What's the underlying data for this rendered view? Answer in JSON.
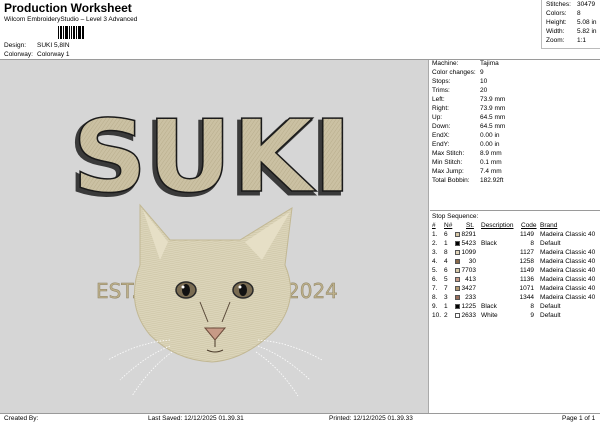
{
  "header": {
    "title": "Production Worksheet",
    "subtitle": "Wilcom EmbroideryStudio – Level 3 Advanced",
    "design_label": "Design:",
    "design_value": "SUKI 5,8IN",
    "colorway_label": "Colorway:",
    "colorway_value": "Colorway 1"
  },
  "stats": [
    {
      "label": "Stitches:",
      "value": "30479"
    },
    {
      "label": "Colors:",
      "value": "8"
    },
    {
      "label": "Height:",
      "value": "5.08 in"
    },
    {
      "label": "Width:",
      "value": "5.82 in"
    },
    {
      "label": "Zoom:",
      "value": "1:1"
    }
  ],
  "design": {
    "word": "SUKI",
    "est": "EST.",
    "year": "2024",
    "colors": {
      "fill": "#cbc1a3",
      "shadow": "#3a3a3a",
      "text": "#bdb08a",
      "fur": "#d9d2b6"
    }
  },
  "machine_info": [
    {
      "label": "Machine:",
      "value": "Tajima"
    },
    {
      "label": "Color changes:",
      "value": "9"
    },
    {
      "label": "Stops:",
      "value": "10"
    },
    {
      "label": "Trims:",
      "value": "20"
    },
    {
      "label": "Left:",
      "value": "73.9 mm"
    },
    {
      "label": "Right:",
      "value": "73.9 mm"
    },
    {
      "label": "Up:",
      "value": "64.5 mm"
    },
    {
      "label": "Down:",
      "value": "64.5 mm"
    },
    {
      "label": "EndX:",
      "value": "0.00 in"
    },
    {
      "label": "EndY:",
      "value": "0.00 in"
    },
    {
      "label": "Max Stitch:",
      "value": "8.9 mm"
    },
    {
      "label": "Min Stitch:",
      "value": "0.1 mm"
    },
    {
      "label": "Max Jump:",
      "value": "7.4 mm"
    },
    {
      "label": "Total Bobbin:",
      "value": "182.92ft"
    }
  ],
  "stop_sequence": {
    "heading": "Stop Sequence:",
    "columns": [
      "#",
      "N#",
      "St.",
      "Description",
      "Code",
      "Brand"
    ],
    "rows": [
      {
        "num": "1.",
        "n": "6",
        "swatch": "#d8c9a8",
        "st": "8291",
        "desc": "",
        "code": "1149",
        "brand": "Madeira Classic 40"
      },
      {
        "num": "2.",
        "n": "1",
        "swatch": "#000000",
        "st": "5423",
        "desc": "Black",
        "code": "8",
        "brand": "Default"
      },
      {
        "num": "3.",
        "n": "8",
        "swatch": "#e3d7bd",
        "st": "1099",
        "desc": "",
        "code": "1127",
        "brand": "Madeira Classic 40"
      },
      {
        "num": "4.",
        "n": "4",
        "swatch": "#8a6a4a",
        "st": "30",
        "desc": "",
        "code": "1258",
        "brand": "Madeira Classic 40"
      },
      {
        "num": "5.",
        "n": "6",
        "swatch": "#d8c9a8",
        "st": "7703",
        "desc": "",
        "code": "1149",
        "brand": "Madeira Classic 40"
      },
      {
        "num": "6.",
        "n": "5",
        "swatch": "#c79a86",
        "st": "413",
        "desc": "",
        "code": "1136",
        "brand": "Madeira Classic 40"
      },
      {
        "num": "7.",
        "n": "7",
        "swatch": "#b59a72",
        "st": "3427",
        "desc": "",
        "code": "1071",
        "brand": "Madeira Classic 40"
      },
      {
        "num": "8.",
        "n": "3",
        "swatch": "#9a6f5c",
        "st": "233",
        "desc": "",
        "code": "1344",
        "brand": "Madeira Classic 40"
      },
      {
        "num": "9.",
        "n": "1",
        "swatch": "#000000",
        "st": "1225",
        "desc": "Black",
        "code": "8",
        "brand": "Default"
      },
      {
        "num": "10.",
        "n": "2",
        "swatch": "#ffffff",
        "st": "2633",
        "desc": "White",
        "code": "9",
        "brand": "Default"
      }
    ]
  },
  "footer": {
    "created_by": "Created By:",
    "last_saved": "Last Saved: 12/12/2025 01.39.31",
    "printed": "Printed: 12/12/2025 01.39.33",
    "page": "Page 1 of 1"
  }
}
